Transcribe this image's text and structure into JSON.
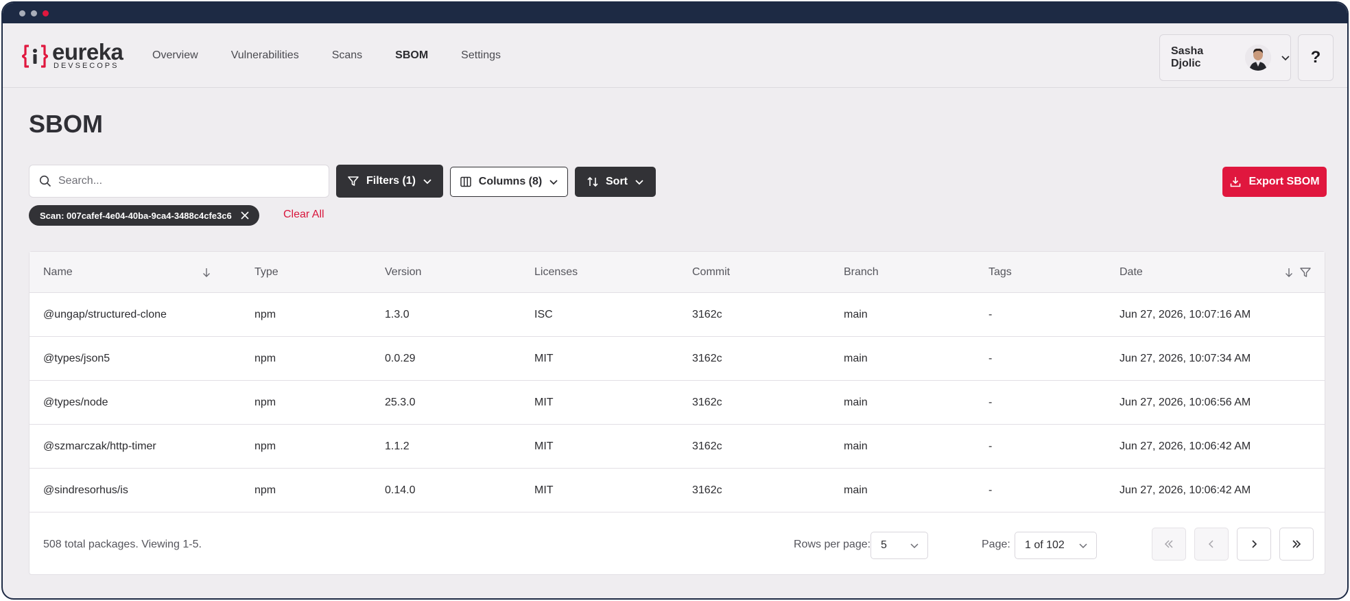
{
  "app": {
    "logo_main": "eureka",
    "logo_sub": "DEVSECOPS",
    "brand_color": "#e0173e"
  },
  "nav": {
    "items": [
      {
        "label": "Overview"
      },
      {
        "label": "Vulnerabilities"
      },
      {
        "label": "Scans"
      },
      {
        "label": "SBOM",
        "active": true
      },
      {
        "label": "Settings"
      }
    ]
  },
  "user": {
    "name": "Sasha Djolic"
  },
  "help": {
    "label": "?"
  },
  "page": {
    "title": "SBOM"
  },
  "toolbar": {
    "search_placeholder": "Search...",
    "filters_label": "Filters (1)",
    "columns_label": "Columns (8)",
    "sort_label": "Sort",
    "export_label": "Export SBOM"
  },
  "active_filter": {
    "chip_label": "Scan: 007cafef-4e04-40ba-9ca4-3488c4cfe3c6",
    "clear_all_label": "Clear All"
  },
  "table": {
    "headers": [
      "Name",
      "Type",
      "Version",
      "Licenses",
      "Commit",
      "Branch",
      "Tags",
      "Date"
    ],
    "rows": [
      [
        "@ungap/structured-clone",
        "npm",
        "1.3.0",
        "ISC",
        "3162c",
        "main",
        "-",
        "Jun 27, 2026, 10:07:16 AM"
      ],
      [
        "@types/json5",
        "npm",
        "0.0.29",
        "MIT",
        "3162c",
        "main",
        "-",
        "Jun 27, 2026, 10:07:34 AM"
      ],
      [
        "@types/node",
        "npm",
        "25.3.0",
        "MIT",
        "3162c",
        "main",
        "-",
        "Jun 27, 2026, 10:06:56 AM"
      ],
      [
        "@szmarczak/http-timer",
        "npm",
        "1.1.2",
        "MIT",
        "3162c",
        "main",
        "-",
        "Jun 27, 2026, 10:06:42 AM"
      ],
      [
        "@sindresorhus/is",
        "npm",
        "0.14.0",
        "MIT",
        "3162c",
        "main",
        "-",
        "Jun 27, 2026, 10:06:42 AM"
      ]
    ]
  },
  "pagination": {
    "summary": "508 total packages. Viewing 1-5.",
    "rows_per_page_label": "Rows per page:",
    "rows_per_page_value": "5",
    "page_label": "Page:",
    "page_value": "1 of 102"
  }
}
